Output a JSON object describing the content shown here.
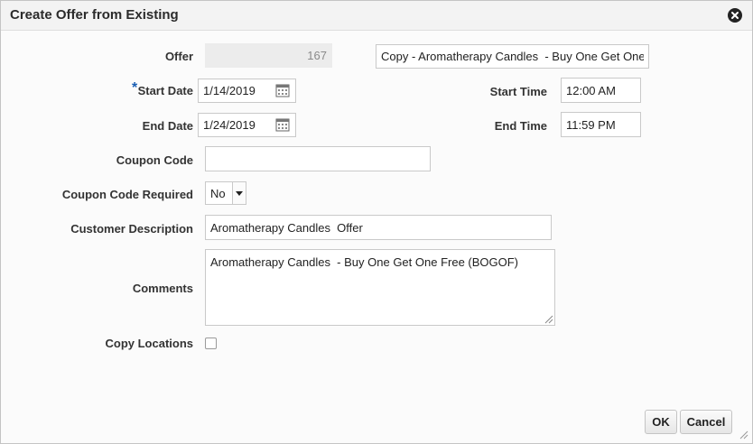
{
  "dialog": {
    "title": "Create Offer from Existing",
    "close_icon": "close-icon"
  },
  "form": {
    "offer": {
      "label": "Offer",
      "id_value": "167",
      "name_value": "Copy - Aromatherapy Candles  - Buy One Get One Free"
    },
    "start_date": {
      "label": "Start Date",
      "required_marker": "*",
      "value": "1/14/2019",
      "icon": "calendar-icon"
    },
    "end_date": {
      "label": "End Date",
      "value": "1/24/2019",
      "icon": "calendar-icon"
    },
    "start_time": {
      "label": "Start Time",
      "value": "12:00 AM"
    },
    "end_time": {
      "label": "End Time",
      "value": "11:59 PM"
    },
    "coupon_code": {
      "label": "Coupon Code",
      "value": ""
    },
    "coupon_code_required": {
      "label": "Coupon Code Required",
      "value": "No"
    },
    "customer_description": {
      "label": "Customer Description",
      "value": "Aromatherapy Candles  Offer"
    },
    "comments": {
      "label": "Comments",
      "value": "Aromatherapy Candles  - Buy One Get One Free (BOGOF)"
    },
    "copy_locations": {
      "label": "Copy Locations",
      "checked": false
    }
  },
  "buttons": {
    "ok": "OK",
    "cancel": "Cancel"
  },
  "colors": {
    "required_star": "#1a5fb4",
    "readonly_field": "#ececec"
  }
}
